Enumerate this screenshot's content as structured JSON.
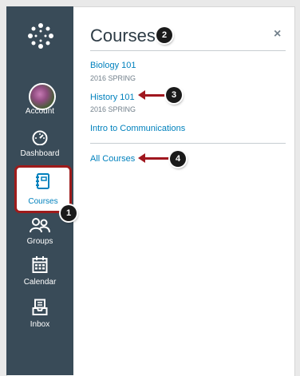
{
  "nav": {
    "items": [
      {
        "label": "Account",
        "icon": "avatar"
      },
      {
        "label": "Dashboard",
        "icon": "dashboard-icon"
      },
      {
        "label": "Courses",
        "icon": "courses-icon"
      },
      {
        "label": "Groups",
        "icon": "groups-icon"
      },
      {
        "label": "Calendar",
        "icon": "calendar-icon"
      },
      {
        "label": "Inbox",
        "icon": "inbox-icon"
      }
    ]
  },
  "tray": {
    "title": "Courses",
    "close": "×",
    "courses": [
      {
        "name": "Biology 101",
        "term": "2016 SPRING"
      },
      {
        "name": "History 101",
        "term": "2016 SPRING"
      },
      {
        "name": "Intro to Communications",
        "term": ""
      }
    ],
    "all_courses": "All Courses"
  },
  "callouts": [
    "1",
    "2",
    "3",
    "4"
  ],
  "colors": {
    "nav_bg": "#394b58",
    "link": "#0081bd",
    "highlight": "#9e1b1b"
  }
}
